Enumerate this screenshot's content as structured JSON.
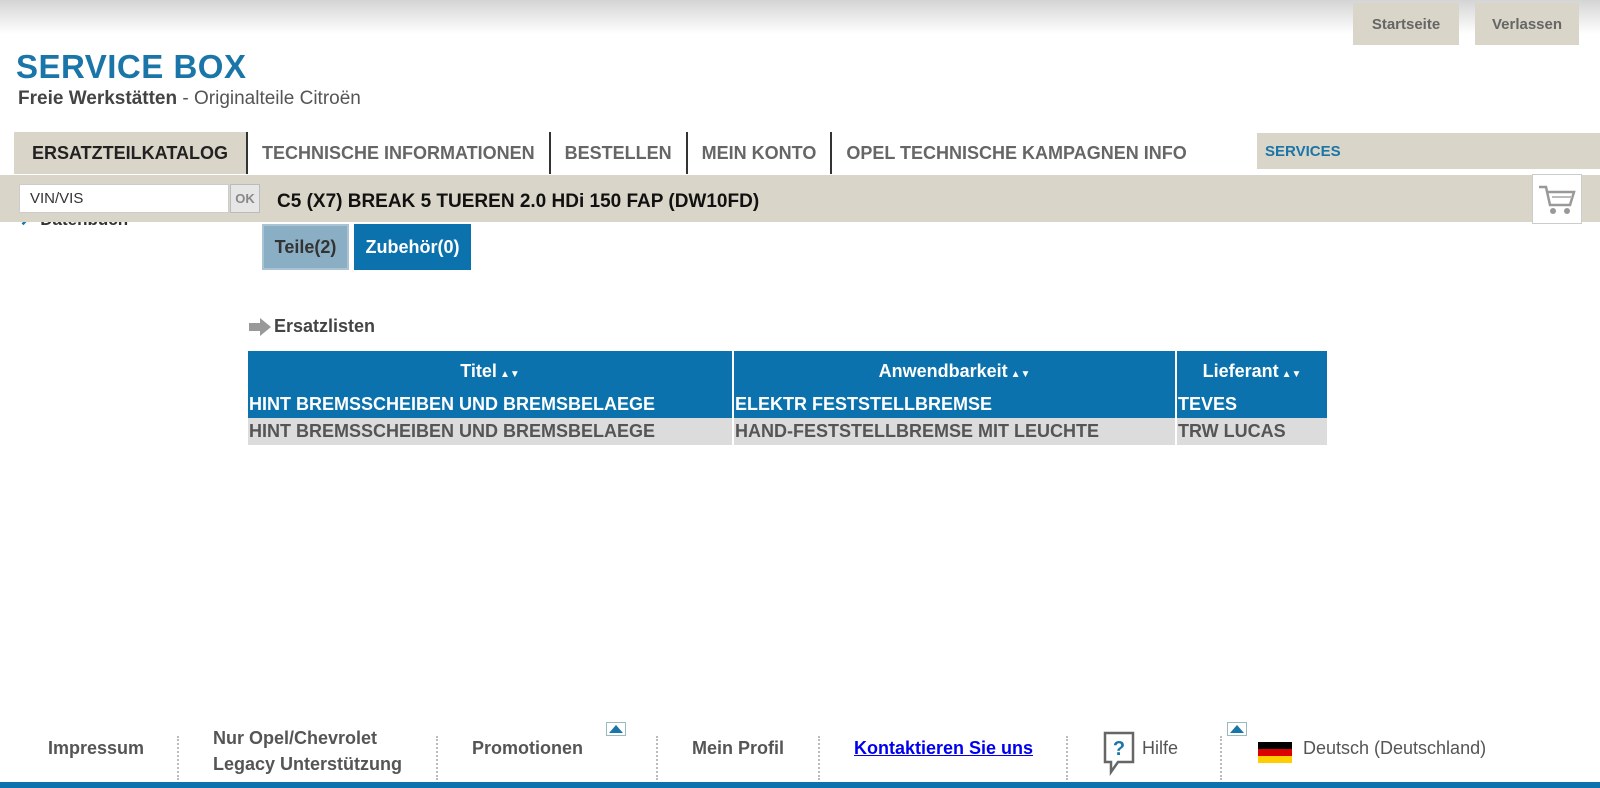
{
  "header": {
    "top_buttons": {
      "home": "Startseite",
      "exit": "Verlassen"
    },
    "brand": "SERVICE BOX",
    "subbrand_bold": "Freie Werkstätten",
    "subbrand_rest": " - Originalteile Citroën"
  },
  "nav": {
    "tabs": [
      {
        "label": "ERSATZTEILKATALOG",
        "active": true
      },
      {
        "label": "TECHNISCHE INFORMATIONEN"
      },
      {
        "label": "BESTELLEN"
      },
      {
        "label": "MEIN KONTO"
      },
      {
        "label": "OPEL TECHNISCHE KAMPAGNEN INFO"
      }
    ],
    "services": "SERVICES"
  },
  "context": {
    "vin_value": "VIN/VIS",
    "ok_label": "OK",
    "vehicle": "C5 (X7) BREAK 5 TUEREN 2.0 HDi 150 FAP (DW10FD)",
    "cart_icon": "shopping-cart-icon"
  },
  "sidebar": {
    "link": "Datenbuch"
  },
  "subtabs": {
    "teile": "Teile(2)",
    "zubehoer": "Zubehör(0)"
  },
  "section": {
    "title": "Ersatzlisten"
  },
  "table": {
    "columns": [
      "Titel",
      "Anwendbarkeit",
      "Lieferant"
    ],
    "rows": [
      [
        "HINT BREMSSCHEIBEN UND BREMSBELAEGE",
        "ELEKTR FESTSTELLBREMSE",
        "TEVES"
      ],
      [
        "HINT BREMSSCHEIBEN UND BREMSBELAEGE",
        "HAND-FESTSTELLBREMSE MIT LEUCHTE",
        "TRW LUCAS"
      ]
    ],
    "sort_glyph": "▲▼"
  },
  "footer": {
    "impressum": "Impressum",
    "legacy_line1": "Nur Opel/Chevrolet",
    "legacy_line2": "Legacy Unterstützung",
    "promotionen": "Promotionen",
    "mein_profil": "Mein Profil",
    "kontakt": "Kontaktieren Sie uns",
    "hilfe": "Hilfe",
    "language": "Deutsch (Deutschland)"
  },
  "colors": {
    "accent": "#0b72ad",
    "brand": "#1a75a8",
    "beige": "#d9d5c8"
  }
}
